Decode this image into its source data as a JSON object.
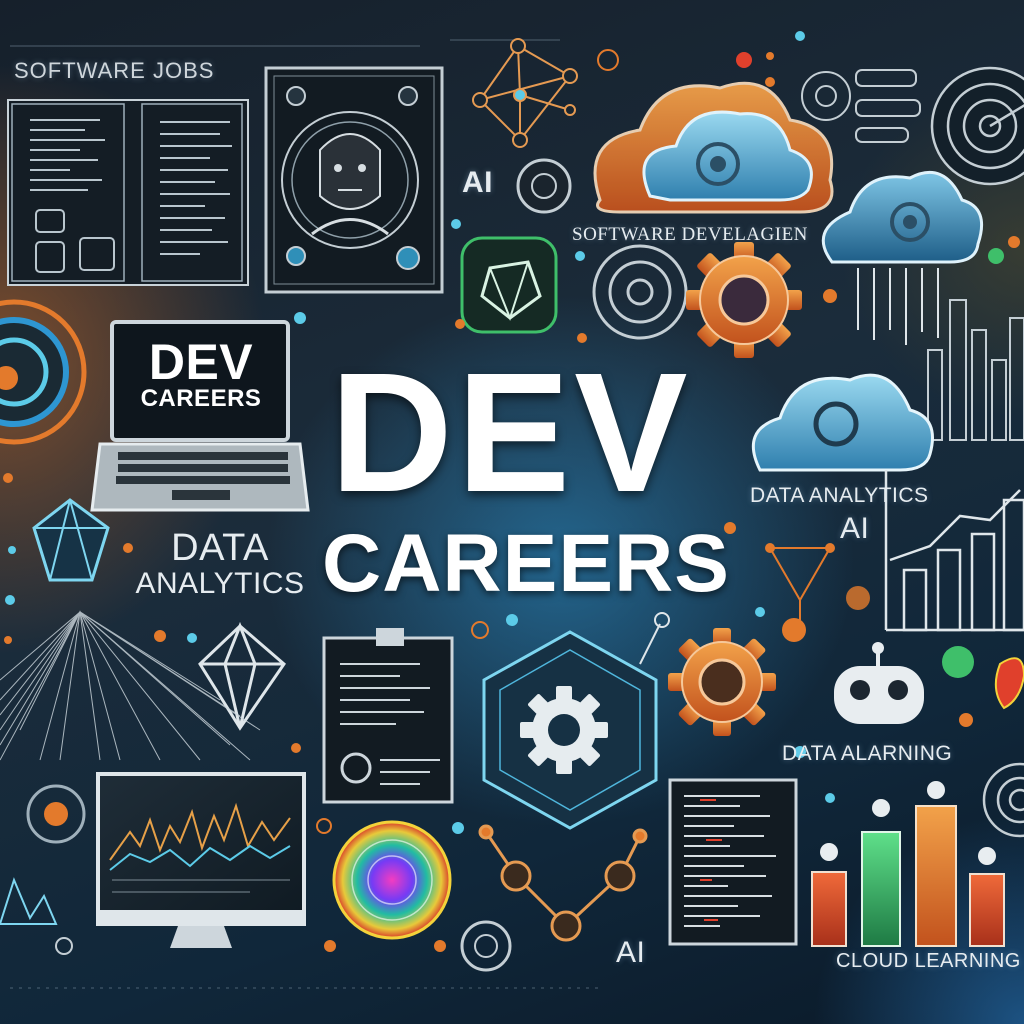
{
  "header": {
    "software_jobs": "SOFTWARE JOBS"
  },
  "headline": {
    "dev": "DEV",
    "careers": "CAREERS"
  },
  "laptop": {
    "line1": "DEV",
    "line2": "CAREERS"
  },
  "labels": {
    "software_develop": "SOFTWARE DEVELAGIEN",
    "data_analytics_left": [
      "DATA",
      "ANALYTICS"
    ],
    "data_analytics_right": "DATA ANALYTICS",
    "ai_top": "AI",
    "ai_right": "AI",
    "ai_bottom": "AI",
    "data_alarning": "DATA ALARNING",
    "cloud_learning": "CLOUD LEARNING"
  },
  "colors": {
    "accent_orange": "#e37a2c",
    "accent_cyan": "#5ccbe8",
    "accent_green": "#3fbf6a",
    "accent_red": "#e0402c",
    "glow_blue": "#2e96d2"
  },
  "icons": [
    "profile-frame-icon",
    "network-graph-icon",
    "cloud-icon",
    "gear-icon",
    "gem-icon",
    "laptop-icon",
    "monitor-icon",
    "clipboard-icon",
    "bar-chart-icon",
    "robot-icon",
    "radar-icon",
    "mountain-mesh-icon",
    "rainbow-orb-icon",
    "hexagon-gear-icon"
  ]
}
